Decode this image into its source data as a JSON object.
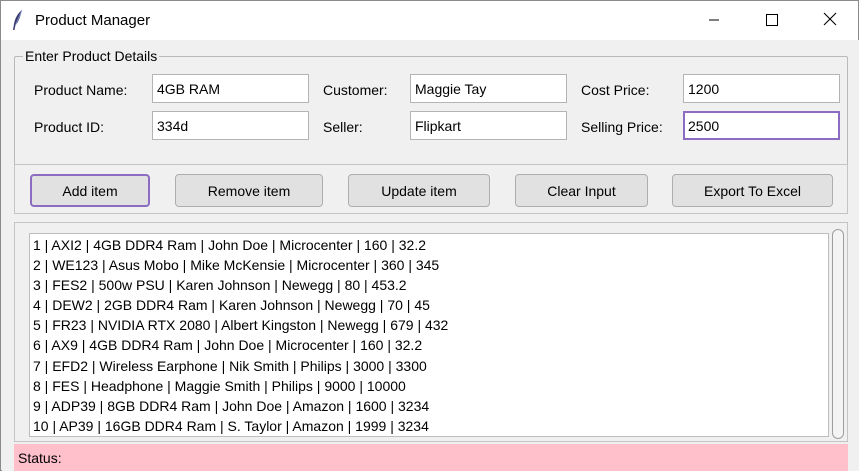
{
  "window": {
    "title": "Product Manager",
    "icon": "feather-icon",
    "controls": [
      "minimize-icon",
      "maximize-icon",
      "close-icon"
    ]
  },
  "details": {
    "legend": "Enter Product Details",
    "product_name": {
      "label": "Product Name:",
      "value": "4GB RAM"
    },
    "product_id": {
      "label": "Product ID:",
      "value": "334d"
    },
    "customer": {
      "label": "Customer:",
      "value": "Maggie Tay"
    },
    "seller": {
      "label": "Seller:",
      "value": "Flipkart"
    },
    "cost_price": {
      "label": "Cost Price:",
      "value": "1200"
    },
    "selling_price": {
      "label": "Selling Price:",
      "value": "2500"
    }
  },
  "actions": {
    "add": "Add item",
    "remove": "Remove item",
    "update": "Update item",
    "clear": "Clear Input",
    "export": "Export To Excel"
  },
  "list": {
    "items": [
      "1 | AXI2 | 4GB DDR4 Ram | John Doe | Microcenter | 160 | 32.2",
      "2 | WE123 | Asus Mobo | Mike McKensie | Microcenter | 360 | 345",
      "3 | FES2 | 500w PSU | Karen Johnson | Newegg | 80 | 453.2",
      "4 | DEW2 | 2GB DDR4 Ram | Karen Johnson | Newegg | 70 | 45",
      "5 | FR23 | NVIDIA RTX 2080 | Albert Kingston | Newegg | 679 | 432",
      "6 | AX9 | 4GB DDR4 Ram | John Doe | Microcenter | 160 | 32.2",
      "7 | EFD2 | Wireless Earphone | Nik Smith | Philips | 3000 | 3300",
      "8 | FES | Headphone | Maggie Smith | Philips | 9000 | 10000",
      "9 | ADP39 | 8GB DDR4 Ram | John Doe | Amazon | 1600 | 3234",
      "10 | AP39 | 16GB DDR4 Ram | S. Taylor | Amazon | 1999 | 3234"
    ]
  },
  "status": {
    "text": "Status:",
    "color": "#ffc0cb"
  },
  "colors": {
    "focus_border": "#8b6cc0",
    "button_bg": "#e1e1e1",
    "window_bg": "#f0f0f0"
  }
}
